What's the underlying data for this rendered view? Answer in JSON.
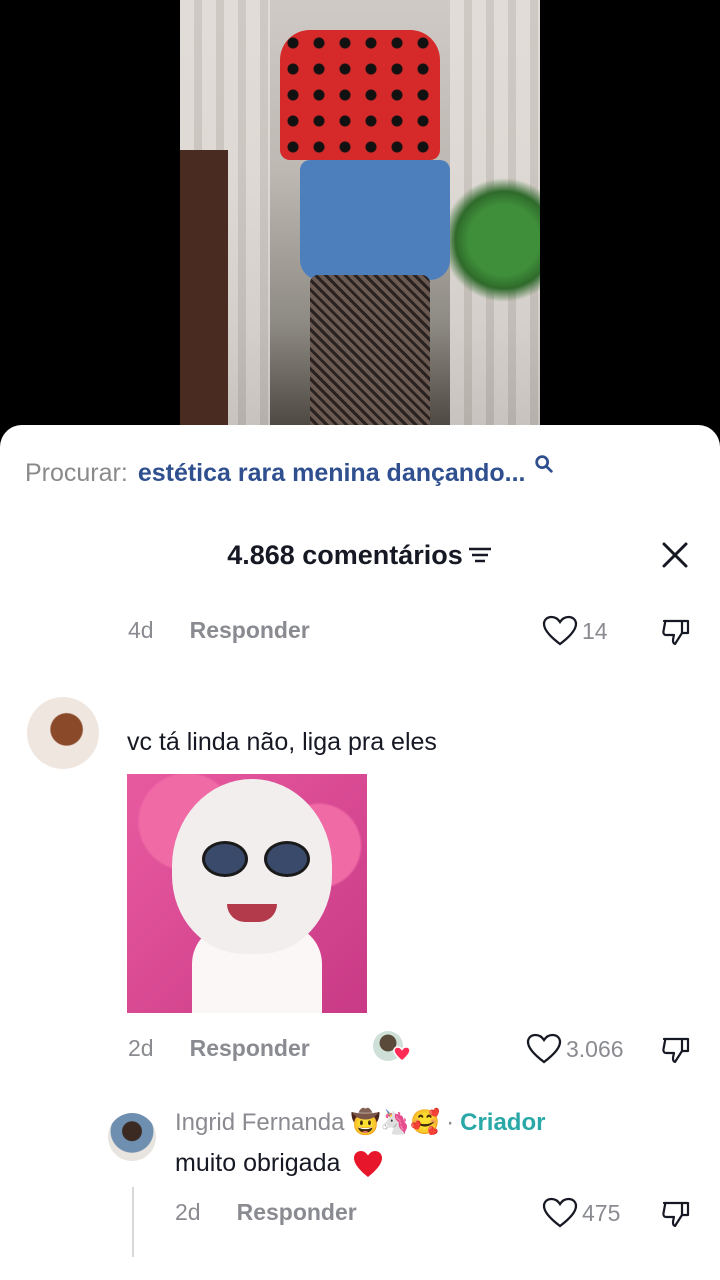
{
  "search": {
    "prefix": "Procurar:",
    "query": "estética rara menina dançando...",
    "icon": "search-icon",
    "accent": "#2f4f8f"
  },
  "comments_header": {
    "count_label": "4.868 comentários",
    "filter_icon": "filter-icon",
    "close_icon": "close-icon"
  },
  "comments": [
    {
      "age": "4d",
      "reply_label": "Responder",
      "likes": "14"
    },
    {
      "text": "vc tá linda não, liga pra eles",
      "has_gif": true,
      "age": "2d",
      "reply_label": "Responder",
      "likes": "3.066",
      "creator_liked": true,
      "replies": [
        {
          "author": "Ingrid Fernanda",
          "author_emojis": "🤠🦄🥰",
          "separator": "·",
          "badge": "Criador",
          "badge_color": "#2aa8a8",
          "text": "muito obrigada",
          "age": "2d",
          "reply_label": "Responder",
          "likes": "475"
        }
      ]
    }
  ]
}
